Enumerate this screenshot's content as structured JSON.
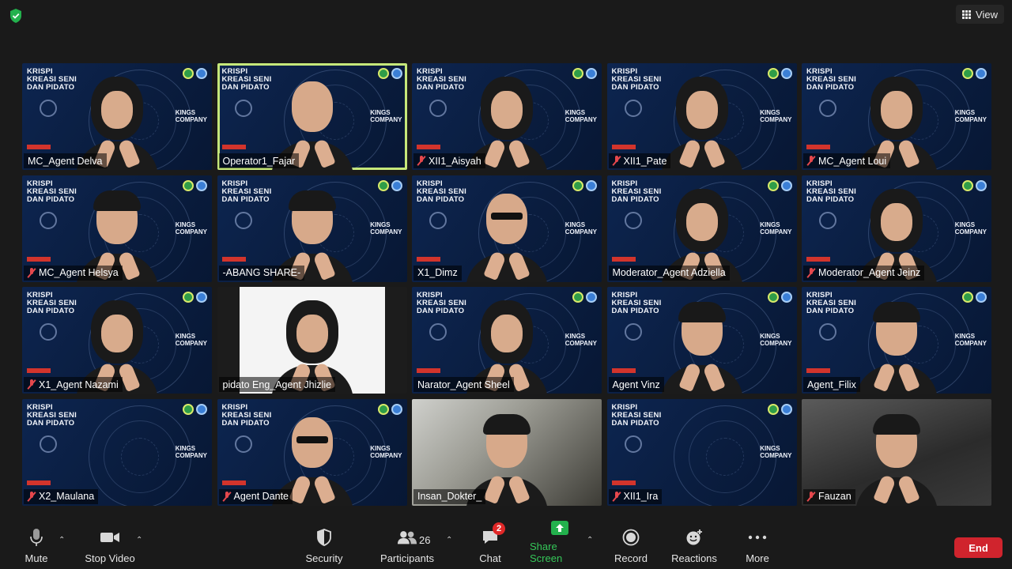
{
  "top": {
    "view_label": "View"
  },
  "participants": [
    {
      "name": "MC_Agent Delva",
      "muted": false,
      "bg": "brand",
      "active": false,
      "person": "hijab"
    },
    {
      "name": "Operator1_Fajar",
      "muted": false,
      "bg": "brand",
      "active": true,
      "person": "plain"
    },
    {
      "name": "XII1_Aisyah",
      "muted": true,
      "bg": "brand",
      "active": false,
      "person": "hijab"
    },
    {
      "name": "XII1_Pate",
      "muted": true,
      "bg": "brand",
      "active": false,
      "person": "hijab"
    },
    {
      "name": "MC_Agent Loui",
      "muted": true,
      "bg": "brand",
      "active": false,
      "person": "hijab"
    },
    {
      "name": "MC_Agent Helsya",
      "muted": true,
      "bg": "brand",
      "active": false,
      "person": "hair"
    },
    {
      "name": "-ABANG SHARE-",
      "muted": false,
      "bg": "brand",
      "active": false,
      "person": "hair"
    },
    {
      "name": "X1_Dimz",
      "muted": false,
      "bg": "brand",
      "active": false,
      "person": "glasses"
    },
    {
      "name": "Moderator_Agent Adziella",
      "muted": false,
      "bg": "brand",
      "active": false,
      "person": "hijab"
    },
    {
      "name": "Moderator_Agent Jeinz",
      "muted": true,
      "bg": "brand",
      "active": false,
      "person": "hijab"
    },
    {
      "name": "X1_Agent Nazami",
      "muted": true,
      "bg": "brand",
      "active": false,
      "person": "hijab"
    },
    {
      "name": "pidato Eng_Agent Jhizlie",
      "muted": false,
      "bg": "white",
      "active": false,
      "person": "hijab"
    },
    {
      "name": "Narator_Agent Sheel",
      "muted": false,
      "bg": "brand",
      "active": false,
      "person": "hijab"
    },
    {
      "name": "Agent Vinz",
      "muted": false,
      "bg": "brand",
      "active": false,
      "person": "hair"
    },
    {
      "name": "Agent_Filix",
      "muted": false,
      "bg": "brand",
      "active": false,
      "person": "hair"
    },
    {
      "name": "X2_Maulana",
      "muted": true,
      "bg": "brand",
      "active": false,
      "person": "none"
    },
    {
      "name": "Agent Dante",
      "muted": true,
      "bg": "brand",
      "active": false,
      "person": "glasses"
    },
    {
      "name": "Insan_Dokter_",
      "muted": false,
      "bg": "photo",
      "active": false,
      "person": "hair"
    },
    {
      "name": "XII1_Ira",
      "muted": true,
      "bg": "brand",
      "active": false,
      "person": "none"
    },
    {
      "name": "Fauzan",
      "muted": true,
      "bg": "gray",
      "active": false,
      "person": "hair"
    }
  ],
  "brand": {
    "title_line1": "KRISPI",
    "title_line2": "KREASI SENI",
    "title_line3": "DAN PIDATO",
    "company_line1": "KINGS",
    "company_line2": "COMPANY"
  },
  "toolbar": {
    "mute": "Mute",
    "stop_video": "Stop Video",
    "security": "Security",
    "participants": "Participants",
    "participants_count": "26",
    "chat": "Chat",
    "chat_badge": "2",
    "share_screen": "Share Screen",
    "record": "Record",
    "reactions": "Reactions",
    "more": "More",
    "end": "End"
  },
  "colors": {
    "active_speaker": "#c6e87a",
    "share_green": "#35c759",
    "end_red": "#d0242d",
    "muted_red": "#e5484d",
    "tile_blue": "#0d2550"
  }
}
